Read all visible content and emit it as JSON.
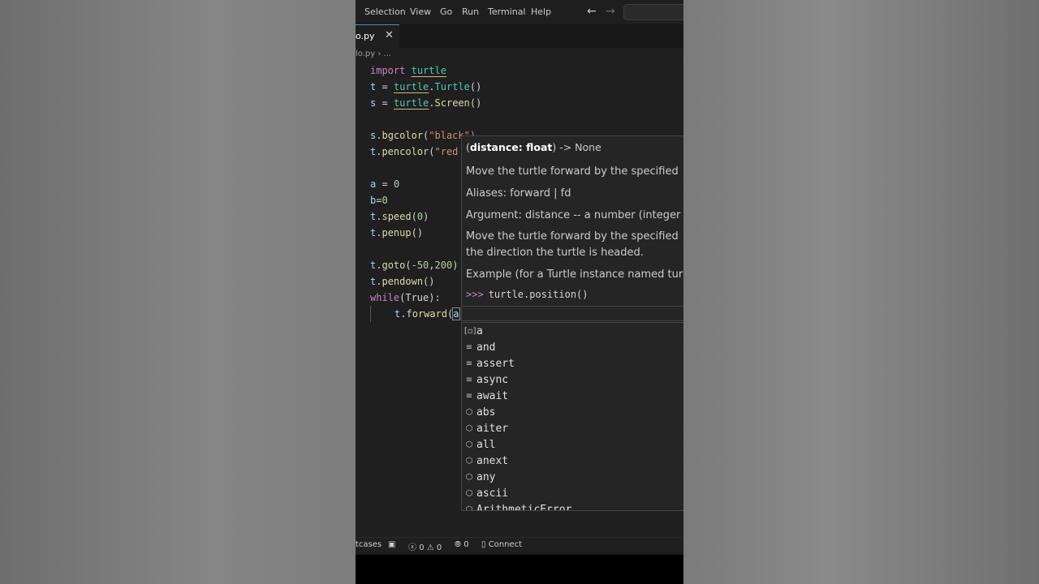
{
  "menu": {
    "items": [
      "Selection",
      "View",
      "Go",
      "Run",
      "Terminal",
      "Help"
    ]
  },
  "tab": {
    "label": "o.py"
  },
  "breadcrumb": {
    "file": "lo.py",
    "sep": "›",
    "rest": "..."
  },
  "code": {
    "l1": [
      "import",
      "turtle"
    ],
    "l2": [
      "t",
      "=",
      "turtle",
      ".",
      "Turtle",
      "()"
    ],
    "l3": [
      "s",
      "=",
      "turtle",
      ".",
      "Screen",
      "()"
    ],
    "l5": [
      "s",
      ".",
      "bgcolor",
      "(",
      "\"black\")"
    ],
    "l6": [
      "t",
      ".",
      "pencolor",
      "(",
      "\"red"
    ],
    "l8": [
      "a",
      "=",
      "0"
    ],
    "l9": [
      "b",
      "=",
      "0"
    ],
    "l10": [
      "t",
      ".",
      "speed",
      "(",
      "0",
      ")"
    ],
    "l11": [
      "t",
      ".",
      "penup",
      "()"
    ],
    "l13": [
      "t",
      ".",
      "goto",
      "(",
      "-50",
      ",",
      "200",
      ")"
    ],
    "l14": [
      "t",
      ".",
      "pendown",
      "()"
    ],
    "l15": [
      "while",
      "(True):"
    ],
    "l16": [
      "t",
      ".",
      "forward",
      "(",
      "a",
      ")"
    ]
  },
  "hover": {
    "sig_open": "(",
    "sig_param": "distance: float",
    "sig_close": ") -> None",
    "doc1": "Move the turtle forward by the specified",
    "doc2": "Aliases: forward | fd",
    "doc3": "Argument: distance -- a number (integer",
    "doc4a": "Move the turtle forward by the specified",
    "doc4b": "the direction the turtle is headed.",
    "doc5": "Example (for a Turtle instance named tur",
    "prompt": ">>>",
    "example": "turtle.position()"
  },
  "suggestions": [
    {
      "label": "a",
      "kind": "variable-icon"
    },
    {
      "label": "and",
      "kind": "keyword-icon"
    },
    {
      "label": "assert",
      "kind": "keyword-icon"
    },
    {
      "label": "async",
      "kind": "keyword-icon"
    },
    {
      "label": "await",
      "kind": "keyword-icon"
    },
    {
      "label": "abs",
      "kind": "function-icon"
    },
    {
      "label": "aiter",
      "kind": "function-icon"
    },
    {
      "label": "all",
      "kind": "function-icon"
    },
    {
      "label": "anext",
      "kind": "function-icon"
    },
    {
      "label": "any",
      "kind": "function-icon"
    },
    {
      "label": "ascii",
      "kind": "function-icon"
    },
    {
      "label": "ArithmeticError",
      "kind": "class-icon"
    }
  ],
  "status": {
    "left": "tcases",
    "errors": "0",
    "warnings": "0",
    "ports": "0",
    "connect": "Connect"
  },
  "colors": {
    "editor_bg": "#1f1f1f",
    "keyword": "#c586c0",
    "type": "#4ec9b0",
    "function": "#dcdcaa",
    "variable": "#9cdcfe",
    "number": "#b5cea8",
    "string": "#ce9178"
  }
}
